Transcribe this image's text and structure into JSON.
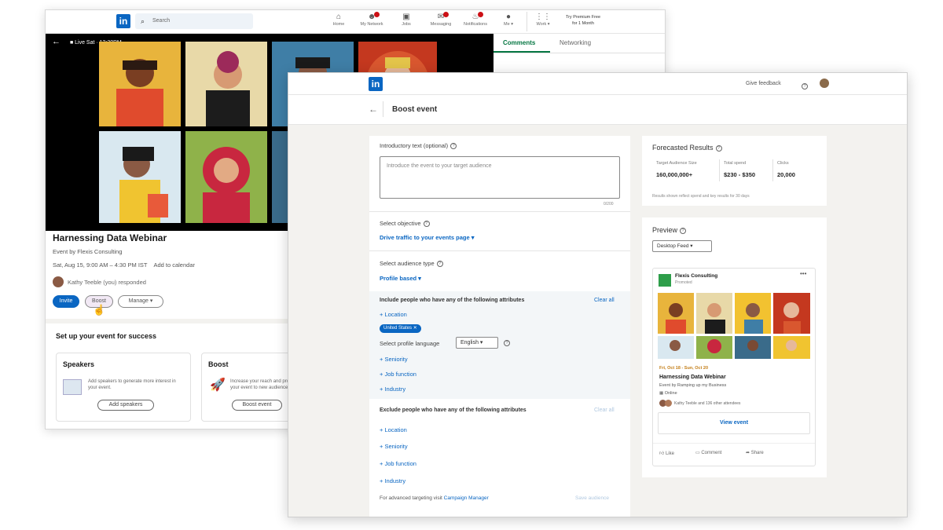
{
  "colors": {
    "brand": "#0a66c2",
    "accent_green": "#057642",
    "notification_red": "#cc1016",
    "promo_orange": "#c37d16"
  },
  "back_window": {
    "logo": "in",
    "search_placeholder": "Search",
    "nav": [
      {
        "label": "Home",
        "icon": "home-icon",
        "badge": false
      },
      {
        "label": "My Network",
        "icon": "people-icon",
        "badge": true
      },
      {
        "label": "Jobs",
        "icon": "briefcase-icon",
        "badge": false
      },
      {
        "label": "Messaging",
        "icon": "message-icon",
        "badge": true
      },
      {
        "label": "Notifications",
        "icon": "bell-icon",
        "badge": true
      },
      {
        "label": "Me ▾",
        "icon": "avatar-icon",
        "badge": false
      },
      {
        "label": "Work ▾",
        "icon": "grid-icon",
        "badge": false
      }
    ],
    "premium_line1": "Try Premium Free",
    "premium_line2": "for 1 Month",
    "live_label": "Live Sat · 12:30PM",
    "tabs": [
      "Comments",
      "Networking"
    ],
    "event": {
      "title": "Harnessing Data Webinar",
      "organizer": "Event by Flexis Consulting",
      "date": "Sat, Aug 15, 9:00 AM – 4:30 PM IST",
      "add_to_calendar": "Add to calendar",
      "responded": "Kathy Teeble (you) responded"
    },
    "buttons": {
      "invite": "Invite",
      "boost": "Boost",
      "manage": "Manage ▾"
    },
    "setup_title": "Set up your event for success",
    "cards": [
      {
        "title": "Speakers",
        "desc": "Add speakers to generate more interest in your event.",
        "button": "Add speakers"
      },
      {
        "title": "Boost",
        "desc": "Increase your reach and promote your event to new audiences.",
        "button": "Boost event"
      }
    ]
  },
  "boost_window": {
    "logo": "in",
    "give_feedback": "Give feedback",
    "page_title": "Boost event",
    "intro_label": "Introductory text (optional)",
    "intro_placeholder": "Introduce the event to your target audience",
    "char_count": "0/200",
    "objective_label": "Select objective",
    "objective_value": "Drive traffic to your events page ▾",
    "audience_type_label": "Select audience type",
    "audience_type_value": "Profile based ▾",
    "include_title": "Include people who have any of the following attributes",
    "clear_all": "Clear all",
    "location": "+ Location",
    "chip": "United States ✕",
    "language_label": "Select profile language",
    "language_value": "English ▾",
    "include_items": [
      "+ Seniority",
      "+ Job function",
      "+ Industry"
    ],
    "exclude_title": "Exclude people who have any of the following attributes",
    "exclude_items": [
      "+ Location",
      "+ Seniority",
      "+ Job function",
      "+ Industry"
    ],
    "advanced_text": "For advanced targeting visit",
    "campaign_manager": "Campaign Manager",
    "save_audience": "Save audience",
    "forecast": {
      "title": "Forecasted Results",
      "cols": [
        {
          "label": "Target Audience Size",
          "value": "160,000,000+"
        },
        {
          "label": "Total spend",
          "value": "$230 - $350"
        },
        {
          "label": "Clicks",
          "value": "20,000"
        }
      ],
      "note": "Results shown reflect spend and key results for 30 days"
    },
    "preview": {
      "title": "Preview",
      "feed_select": "Desktop Feed ▾",
      "company": "Flexis Consulting",
      "promoted": "Promoted",
      "more": "•••",
      "dates": "Fri, Oct 18 - Sun, Oct 20",
      "event_title": "Harnessing Data Webinar",
      "event_by": "Event by Ramping up my Business",
      "online": "Online",
      "attendees": "Kathy Teeble and 136 other attendees",
      "view_event": "View event",
      "actions": [
        "Like",
        "Comment",
        "Share"
      ]
    }
  }
}
